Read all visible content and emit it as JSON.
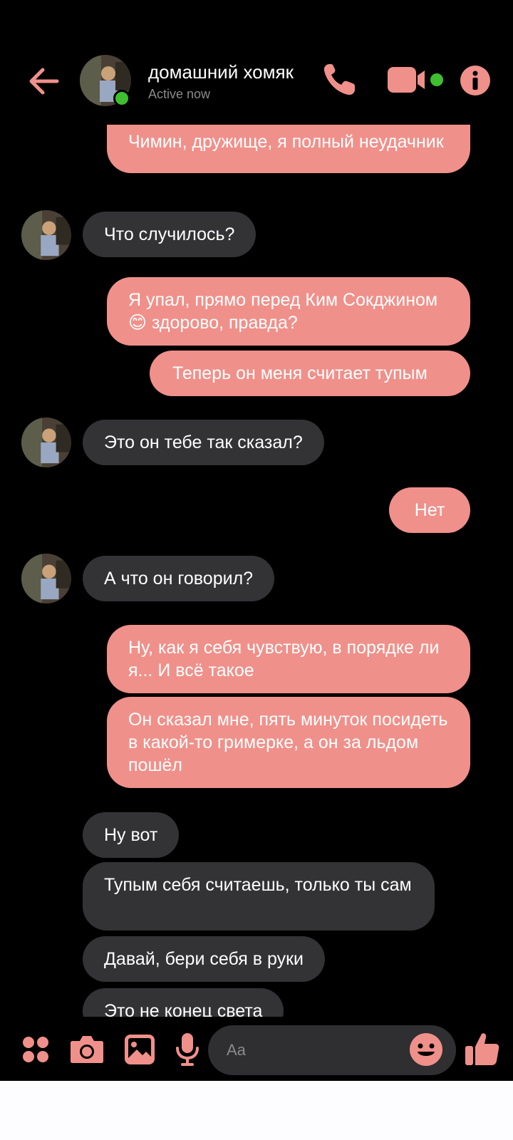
{
  "header": {
    "title": "домашний хомяк",
    "status": "Active now"
  },
  "messages": [
    {
      "from": "me",
      "text": "Чимин, дружище, я полный неудачник"
    },
    {
      "from": "them",
      "text": "Что случилось?"
    },
    {
      "from": "me",
      "text_before": "Я упал, прямо перед Ким Сокджином",
      "emoji": "😊",
      "text_after": "здорово, правда?"
    },
    {
      "from": "me",
      "text": "Теперь он меня считает тупым"
    },
    {
      "from": "them",
      "text": "Это он тебе так сказал?"
    },
    {
      "from": "me",
      "text": "Нет"
    },
    {
      "from": "them",
      "text": "А что он говорил?"
    },
    {
      "from": "me",
      "text": "Ну, как я себя чувствую, в порядке ли я... И всё такое"
    },
    {
      "from": "me",
      "text": "Он сказал мне, пять минуток посидеть в какой-то гримерке, а он за льдом пошёл"
    },
    {
      "from": "them",
      "text": "Ну вот"
    },
    {
      "from": "them",
      "text": "Тупым себя считаешь, только ты сам"
    },
    {
      "from": "them",
      "text": "Давай, бери себя в руки"
    },
    {
      "from": "them",
      "text": "Это не конец света"
    }
  ],
  "composer": {
    "placeholder": "Aa"
  },
  "colors": {
    "accent": "#f0908a",
    "incoming_bubble": "#333336",
    "online": "#3fbf2f",
    "background": "#000000"
  },
  "icons": [
    "back-arrow-icon",
    "phone-icon",
    "video-camera-icon",
    "info-icon",
    "apps-grid-icon",
    "camera-icon",
    "gallery-icon",
    "microphone-icon",
    "emoji-icon",
    "thumbs-up-icon"
  ]
}
